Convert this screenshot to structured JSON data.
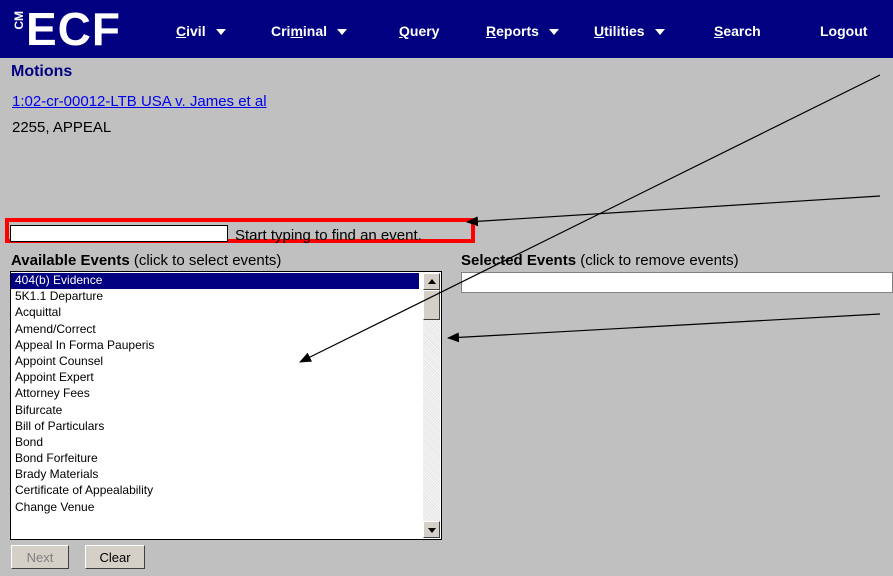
{
  "app": {
    "logo_side": "CM",
    "logo_main": "ECF",
    "menu": [
      {
        "label": "Civil",
        "accel": "C",
        "dropdown": true
      },
      {
        "label": "Criminal",
        "accel": "m",
        "dropdown": true
      },
      {
        "label": "Query",
        "accel": "Q",
        "dropdown": false
      },
      {
        "label": "Reports",
        "accel": "R",
        "dropdown": true
      },
      {
        "label": "Utilities",
        "accel": "U",
        "dropdown": true
      },
      {
        "label": "Search",
        "accel": "S",
        "dropdown": false
      },
      {
        "label": "Logout",
        "accel": "",
        "dropdown": false
      }
    ]
  },
  "page": {
    "title": "Motions",
    "case_link": "1:02-cr-00012-LTB USA v. James et al",
    "subtitle": "2255, APPEAL"
  },
  "search": {
    "value": "",
    "hint": "Start typing to find an event."
  },
  "available": {
    "label_bold": "Available Events",
    "label_rest": " (click to select events)",
    "items": [
      "404(b) Evidence",
      "5K1.1 Departure",
      "Acquittal",
      "Amend/Correct",
      "Appeal In Forma Pauperis",
      "Appoint Counsel",
      "Appoint Expert",
      "Attorney Fees",
      "Bifurcate",
      "Bill of Particulars",
      "Bond",
      "Bond Forfeiture",
      "Brady Materials",
      "Certificate of Appealability",
      "Change Venue"
    ],
    "selected_index": 0
  },
  "selected": {
    "label_bold": "Selected Events",
    "label_rest": " (click to remove events)"
  },
  "buttons": {
    "next": "Next",
    "clear": "Clear"
  },
  "colors": {
    "nav_bg": "#000080",
    "highlight_box": "#ff0000",
    "link": "#0000ee"
  }
}
